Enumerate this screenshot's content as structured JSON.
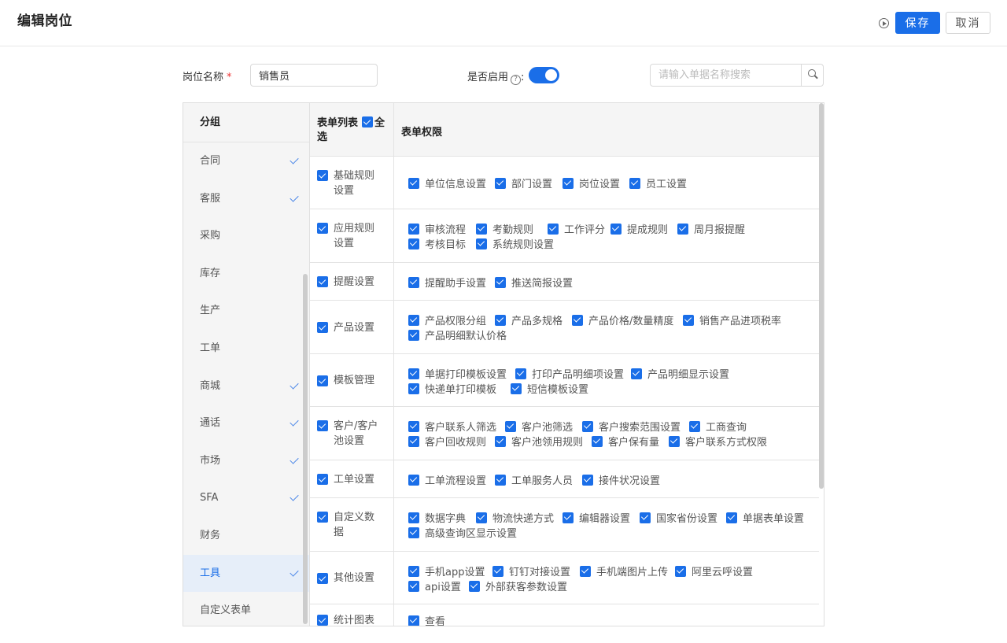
{
  "header": {
    "title": "编辑岗位",
    "save_label": "保存",
    "cancel_label": "取消"
  },
  "form": {
    "name_label": "岗位名称",
    "name_required_mark": "*",
    "name_value": "销售员",
    "enable_label": "是否启用",
    "enable_help_glyph": "?",
    "enable_suffix": ":",
    "enabled": true,
    "search_placeholder": "请输入单据名称搜索"
  },
  "sidebar": {
    "header": "分组",
    "items": [
      {
        "label": "合同",
        "checked": true
      },
      {
        "label": "客服",
        "checked": true
      },
      {
        "label": "采购",
        "checked": false
      },
      {
        "label": "库存",
        "checked": false
      },
      {
        "label": "生产",
        "checked": false
      },
      {
        "label": "工单",
        "checked": false
      },
      {
        "label": "商城",
        "checked": true
      },
      {
        "label": "通话",
        "checked": true
      },
      {
        "label": "市场",
        "checked": true
      },
      {
        "label": "SFA",
        "checked": true
      },
      {
        "label": "财务",
        "checked": false
      },
      {
        "label": "工具",
        "checked": true,
        "active": true
      },
      {
        "label": "自定义表单",
        "checked": false
      }
    ]
  },
  "table": {
    "col1_header": "表单列表",
    "select_all_label": "全选",
    "col2_header": "表单权限",
    "accent_color": "#1a6ee8",
    "rows": [
      {
        "form": "基础规则设置",
        "perms": [
          "单位信息设置",
          "部门设置",
          "岗位设置",
          "员工设置"
        ]
      },
      {
        "form": "应用规则设置",
        "perms": [
          "审核流程",
          "考勤规则",
          "工作评分",
          "提成规则",
          "周月报提醒",
          "考核目标",
          "系统规则设置"
        ]
      },
      {
        "form": "提醒设置",
        "perms": [
          "提醒助手设置",
          "推送简报设置"
        ]
      },
      {
        "form": "产品设置",
        "perms": [
          "产品权限分组",
          "产品多规格",
          "产品价格/数量精度",
          "销售产品进项税率",
          "产品明细默认价格"
        ]
      },
      {
        "form": "模板管理",
        "perms": [
          "单据打印模板设置",
          "打印产品明细项设置",
          "产品明细显示设置",
          "快递单打印模板",
          "短信模板设置"
        ]
      },
      {
        "form": "客户/客户池设置",
        "perms": [
          "客户联系人筛选",
          "客户池筛选",
          "客户搜索范围设置",
          "工商查询",
          "客户回收规则",
          "客户池领用规则",
          "客户保有量",
          "客户联系方式权限"
        ]
      },
      {
        "form": "工单设置",
        "perms": [
          "工单流程设置",
          "工单服务人员",
          "接件状况设置"
        ]
      },
      {
        "form": "自定义数据",
        "perms": [
          "数据字典",
          "物流快递方式",
          "编辑器设置",
          "国家省份设置",
          "单据表单设置",
          "高级查询区显示设置"
        ]
      },
      {
        "form": "其他设置",
        "perms": [
          "手机app设置",
          "钉钉对接设置",
          "手机端图片上传",
          "阿里云呼设置",
          "api设置",
          "外部获客参数设置"
        ]
      },
      {
        "form": "统计图表",
        "perms": [
          "查看"
        ]
      }
    ]
  }
}
